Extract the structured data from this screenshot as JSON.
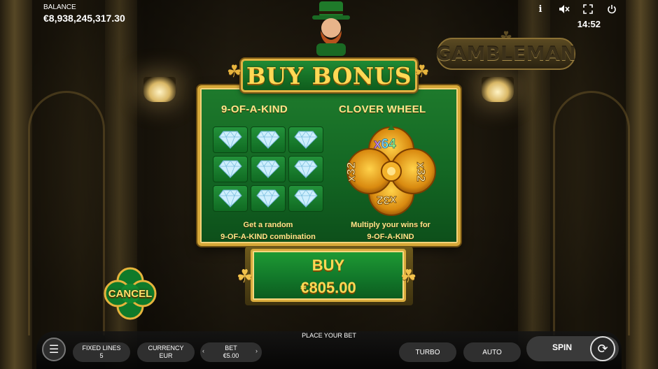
{
  "header": {
    "balance_label": "BALANCE",
    "balance_value": "€8,938,245,317.30",
    "clock": "14:52",
    "icons": [
      "info-icon",
      "mute-icon",
      "fullscreen-icon",
      "power-icon"
    ],
    "info_glyph": "i",
    "mute_glyph": "🔇",
    "fullscreen_glyph": "⛶",
    "power_glyph": "⏻"
  },
  "logo": {
    "text": "GAMBLEMAN"
  },
  "buy_bonus": {
    "title": "BUY BONUS",
    "option_left": {
      "title": "9-OF-A-KIND",
      "desc_line1": "Get a random",
      "desc_line2": "9-OF-A-KIND combination",
      "symbol": "diamond-icon",
      "symbol_count": 9
    },
    "option_right": {
      "title": "CLOVER WHEEL",
      "desc_line1": "Multiply your wins for",
      "desc_line2": "9-OF-A-KIND",
      "mult_top": "x64",
      "mult_right": "x32",
      "mult_bottom": "x32",
      "mult_left": "x32"
    },
    "buy_label": "BUY",
    "buy_price": "€805.00",
    "cancel_label": "CANCEL"
  },
  "bottom": {
    "place_bet": "PLACE YOUR BET",
    "fixed_lines_label": "FIXED LINES",
    "fixed_lines_value": "5",
    "currency_label": "CURRENCY",
    "currency_value": "EUR",
    "bet_label": "BET",
    "bet_value": "€5.00",
    "bet_left_arrow": "‹",
    "bet_right_arrow": "›",
    "turbo_label": "TURBO",
    "auto_label": "AUTO",
    "spin_label": "SPIN",
    "menu_glyph": "☰",
    "spin_glyph": "⟳"
  },
  "colors": {
    "panel_green": "#136623",
    "gold": "#ffd955",
    "frame_gold": "#d6a838"
  }
}
